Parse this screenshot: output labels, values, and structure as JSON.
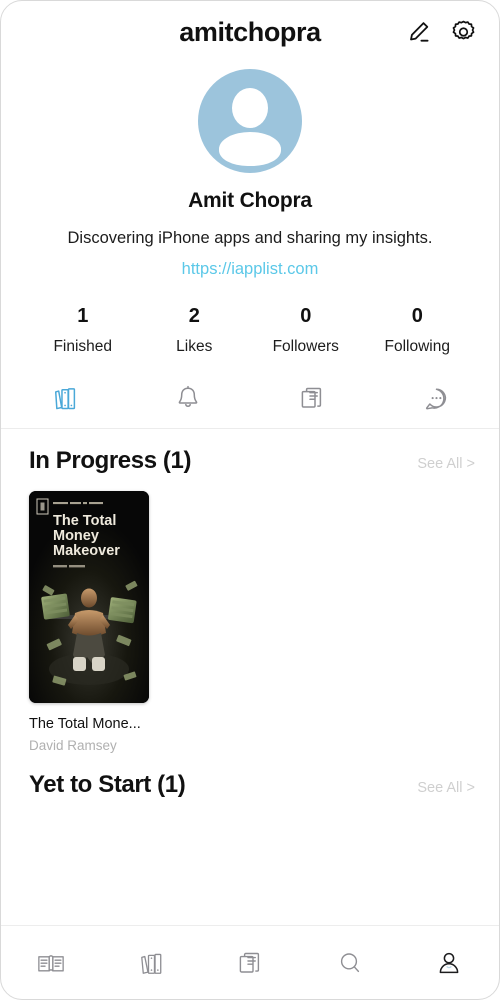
{
  "header": {
    "title": "amitchopra",
    "edit_icon": "pencil-edit-icon",
    "settings_icon": "gear-icon"
  },
  "profile": {
    "avatar_icon": "person-avatar-placeholder",
    "avatar_color": "#9cc4dc",
    "full_name": "Amit Chopra",
    "bio": "Discovering iPhone apps and sharing my insights.",
    "website": "https://iapplist.com",
    "website_color": "#5bc8e8"
  },
  "stats": [
    {
      "value": "1",
      "label": "Finished"
    },
    {
      "value": "2",
      "label": "Likes"
    },
    {
      "value": "0",
      "label": "Followers"
    },
    {
      "value": "0",
      "label": "Following"
    }
  ],
  "tabs": [
    {
      "icon": "books-shelf-icon",
      "active": true
    },
    {
      "icon": "bell-icon",
      "active": false
    },
    {
      "icon": "documents-icon",
      "active": false
    },
    {
      "icon": "chat-bubble-icon",
      "active": false
    }
  ],
  "sections": [
    {
      "title": "In Progress (1)",
      "see_all": "See All >",
      "books": [
        {
          "title": "The Total Mone...",
          "author": "David Ramsey",
          "cover": {
            "kicker": "Key Insights & Analysis",
            "title_lines": [
              "The Total",
              "Money",
              "Makeover"
            ],
            "author": "Dave Ramsey",
            "background": "#0a0a0a"
          }
        }
      ]
    },
    {
      "title": "Yet to Start (1)",
      "see_all": "See All >",
      "books": []
    }
  ],
  "bottom_nav": [
    {
      "icon": "open-book-icon",
      "active": false
    },
    {
      "icon": "bookshelf-icon",
      "active": false
    },
    {
      "icon": "documents-icon",
      "active": false
    },
    {
      "icon": "search-icon",
      "active": false
    },
    {
      "icon": "profile-person-icon",
      "active": true
    }
  ],
  "colors": {
    "accent": "#4aa8d8",
    "link": "#5bc8e8",
    "muted": "#b0b0b0"
  }
}
